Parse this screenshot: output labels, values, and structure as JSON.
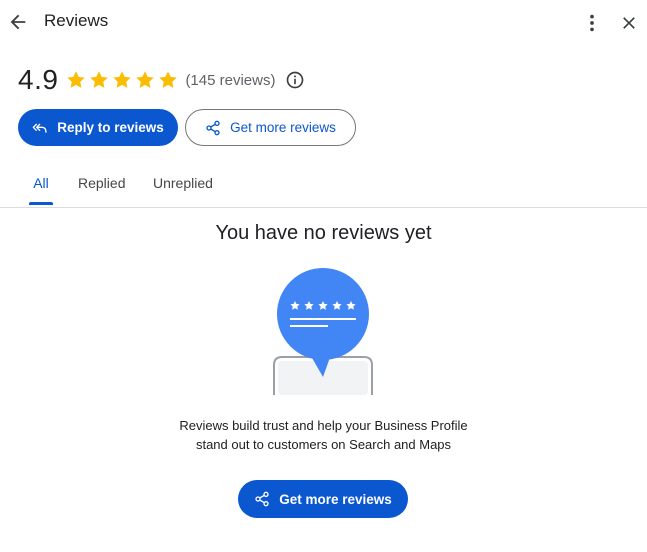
{
  "header": {
    "title": "Reviews",
    "back_icon": "arrow-back-icon",
    "more_icon": "more-vert-icon",
    "close_icon": "close-icon"
  },
  "rating": {
    "value": "4.9",
    "stars": 5,
    "count_text": "(145 reviews)",
    "star_color": "#fbbc04"
  },
  "actions": {
    "reply_label": "Reply to reviews",
    "get_more_label": "Get more reviews"
  },
  "tabs": [
    {
      "label": "All",
      "active": true
    },
    {
      "label": "Replied",
      "active": false
    },
    {
      "label": "Unreplied",
      "active": false
    }
  ],
  "empty_state": {
    "title": "You have no reviews yet",
    "line1": "Reviews build trust and help your Business Profile",
    "line2": "stand out to customers on Search and Maps",
    "cta_label": "Get more reviews"
  },
  "colors": {
    "accent": "#0b57d0",
    "illustration_blue": "#4285f4"
  }
}
